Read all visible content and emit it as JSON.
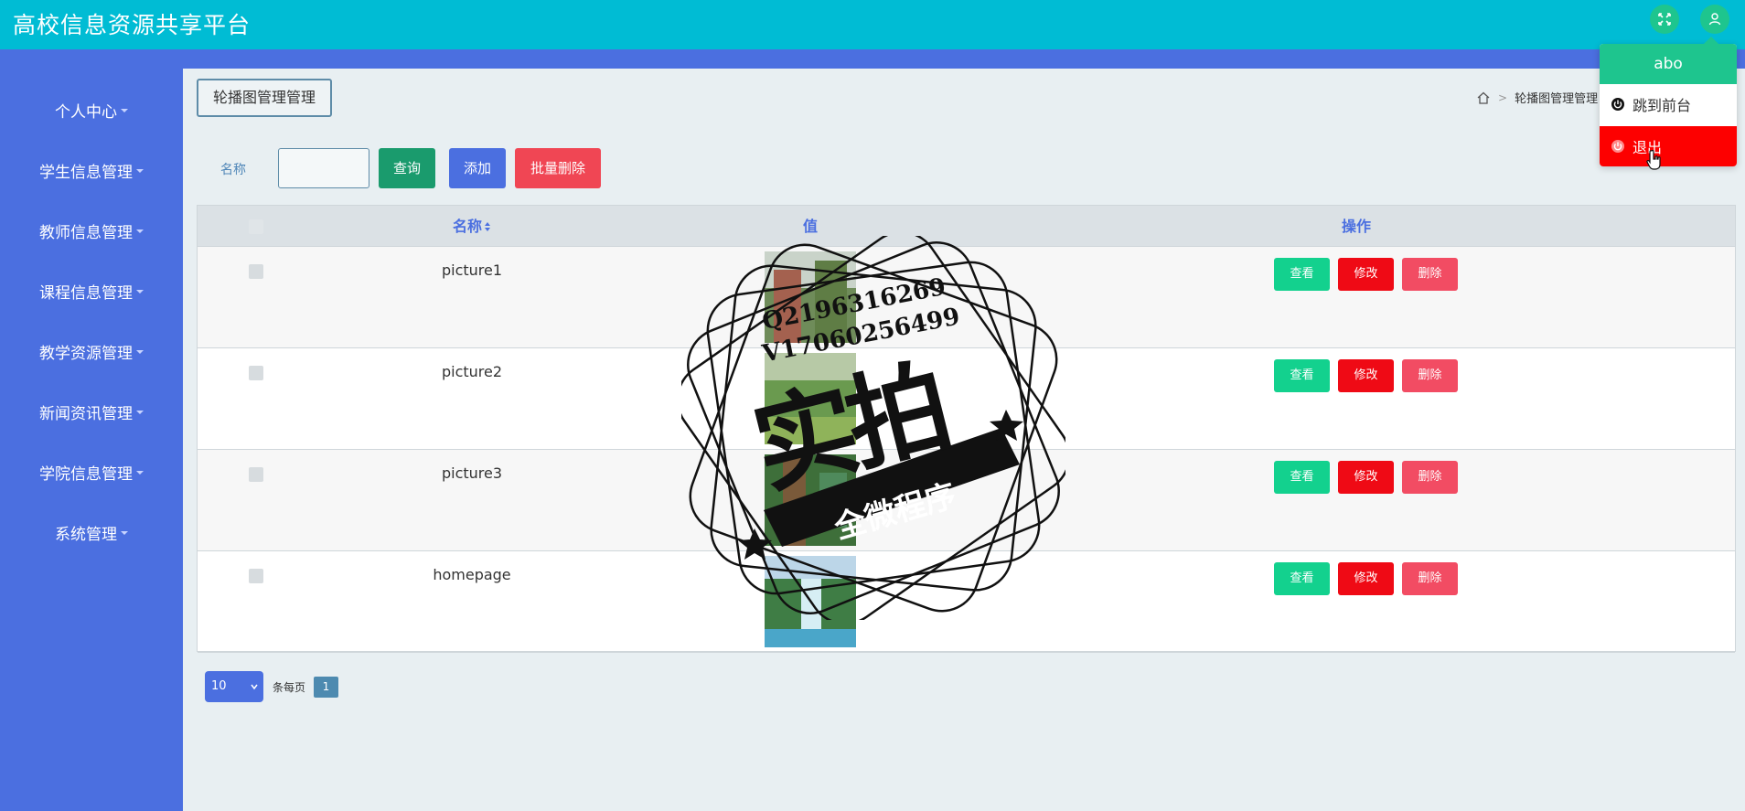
{
  "app": {
    "title": "高校信息资源共享平台"
  },
  "sidebar": {
    "items": [
      {
        "label": "个人中心"
      },
      {
        "label": "学生信息管理"
      },
      {
        "label": "教师信息管理"
      },
      {
        "label": "课程信息管理"
      },
      {
        "label": "教学资源管理"
      },
      {
        "label": "新闻资讯管理"
      },
      {
        "label": "学院信息管理"
      },
      {
        "label": "系统管理"
      }
    ]
  },
  "page": {
    "title": "轮播图管理管理",
    "breadcrumb": "轮播图管理管理"
  },
  "search": {
    "label": "名称",
    "value": "",
    "query_label": "查询",
    "add_label": "添加",
    "batch_delete_label": "批量删除"
  },
  "table": {
    "columns": {
      "name": "名称",
      "value": "值",
      "actions": "操作"
    },
    "rows": [
      {
        "name": "picture1"
      },
      {
        "name": "picture2"
      },
      {
        "name": "picture3"
      },
      {
        "name": "homepage"
      }
    ],
    "action_labels": {
      "view": "查看",
      "edit": "修改",
      "delete": "删除"
    }
  },
  "pagination": {
    "page_size": "10",
    "per_page_label": "条每页",
    "current_page": "1"
  },
  "user_menu": {
    "username": "abo",
    "front_label": "跳到前台",
    "logout_label": "退出"
  },
  "watermark": {
    "line1": "Q2196316269",
    "line2": "V17060256499",
    "big": "实拍",
    "small": "全微程序"
  },
  "colors": {
    "header": "#00bcd4",
    "sidebar": "#4b6fe0",
    "accent_green": "#1ec58e",
    "danger": "#fd0000"
  }
}
